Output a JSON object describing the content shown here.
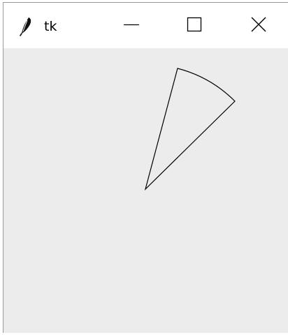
{
  "window": {
    "title": "tk",
    "icon": "feather-icon",
    "controls": {
      "minimize": "minimize-icon",
      "maximize": "maximize-icon",
      "close": "close-icon"
    }
  },
  "canvas": {
    "background": "#ececec",
    "shape": "arc",
    "arc_style": "pieslice",
    "fill": "none",
    "outline": "#000000"
  }
}
